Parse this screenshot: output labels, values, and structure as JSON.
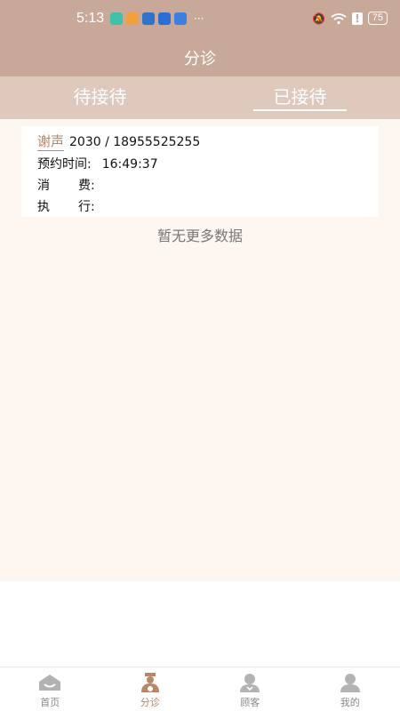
{
  "status_bar": {
    "time": "5:13",
    "battery": "75",
    "more": "···"
  },
  "header": {
    "title": "分诊"
  },
  "tabs": [
    {
      "label": "待接待",
      "active": false
    },
    {
      "label": "已接待",
      "active": true
    }
  ],
  "card": {
    "name": "谢声",
    "id_phone": "2030 / 18955525255",
    "appointment_label": "预约时间:",
    "appointment_time": "16:49:37",
    "consume_label_a": "消",
    "consume_label_b": "费:",
    "execute_label_a": "执",
    "execute_label_b": "行:"
  },
  "list": {
    "no_more": "暂无更多数据"
  },
  "bottom_nav": [
    {
      "label": "首页",
      "icon": "home-icon",
      "active": false
    },
    {
      "label": "分诊",
      "icon": "triage-icon",
      "active": true
    },
    {
      "label": "顾客",
      "icon": "customer-icon",
      "active": false
    },
    {
      "label": "我的",
      "icon": "profile-icon",
      "active": false
    }
  ],
  "colors": {
    "header": "#c8a898",
    "tab_bar": "#dfc8bc",
    "content_bg": "#fdf6f1",
    "accent": "#b88768"
  }
}
